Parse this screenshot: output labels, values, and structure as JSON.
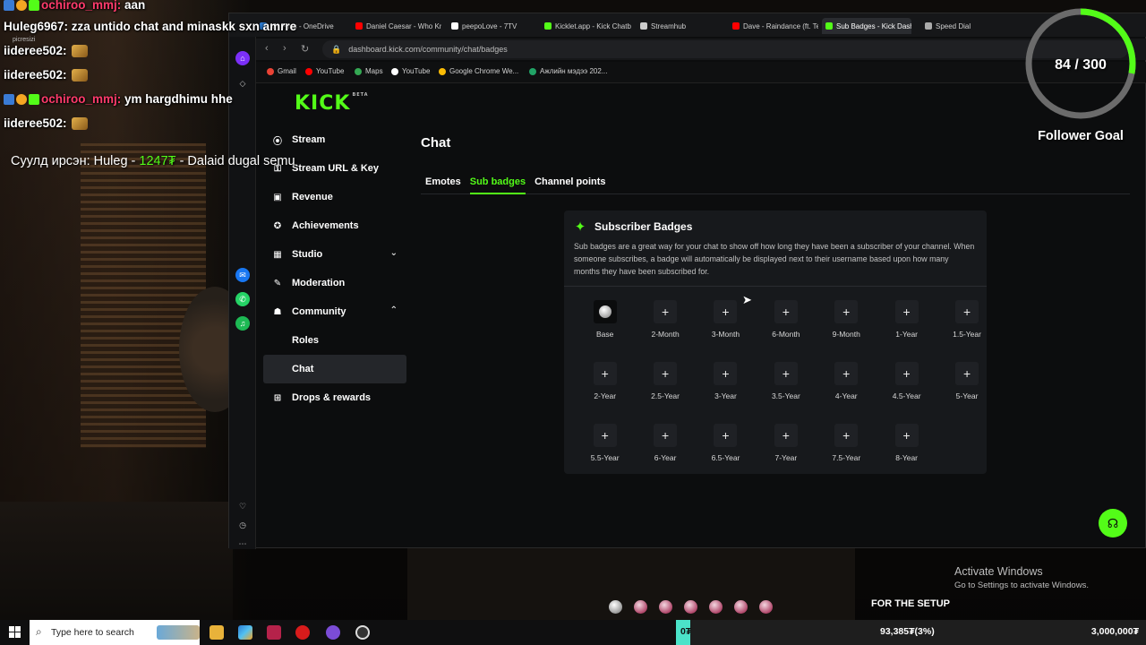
{
  "browser": {
    "tabs": [
      {
        "label": "My Files - OneDrive",
        "color": "#2b7cd3"
      },
      {
        "label": "Daniel Caesar - Who Kn",
        "color": "#ff0000"
      },
      {
        "label": "peepoLove - 7TV",
        "color": "#ffffff"
      },
      {
        "label": "Kicklet.app - Kick Chatb",
        "color": "#53fc18"
      },
      {
        "label": "Streamhub",
        "color": "#cccccc"
      },
      {
        "label": "Dave - Raindance (ft. Te",
        "color": "#ff0000"
      },
      {
        "label": "Sub Badges - Kick Dashb",
        "color": "#53fc18"
      },
      {
        "label": "Speed Dial",
        "color": "#aaaaaa"
      }
    ],
    "url": "dashboard.kick.com/community/chat/badges",
    "bookmarks": [
      {
        "label": "Gmail",
        "color": "#ea4335"
      },
      {
        "label": "YouTube",
        "color": "#ff0000"
      },
      {
        "label": "Maps",
        "color": "#34a853"
      },
      {
        "label": "YouTube",
        "color": "#ffffff"
      },
      {
        "label": "Google Chrome We...",
        "color": "#fbbc05"
      },
      {
        "label": "Ажлийн мэдээ 202...",
        "color": "#21a366"
      }
    ]
  },
  "kick": {
    "logo": "KICK",
    "logo_badge": "BETA",
    "nav": [
      {
        "label": "Stream",
        "icon": "((·))"
      },
      {
        "label": "Stream URL & Key",
        "icon": "⚿"
      },
      {
        "label": "Revenue",
        "icon": "▣"
      },
      {
        "label": "Achievements",
        "icon": "✪"
      },
      {
        "label": "Studio",
        "icon": "▦"
      },
      {
        "label": "Moderation",
        "icon": "🔧"
      },
      {
        "label": "Community",
        "icon": "👥"
      },
      {
        "label": "Roles",
        "icon": ""
      },
      {
        "label": "Chat",
        "icon": ""
      },
      {
        "label": "Drops & rewards",
        "icon": "⊞"
      }
    ],
    "page_title": "Chat",
    "tabs": [
      "Emotes",
      "Sub badges",
      "Channel points"
    ],
    "card": {
      "title": "Subscriber Badges",
      "description": "Sub badges are a great way for your chat to show off how long they have been a subscriber of your channel. When someone subscribes, a badge will automatically be displayed next to their username based upon how many months they have been subscribed for.",
      "badges": [
        "Base",
        "2-Month",
        "3-Month",
        "6-Month",
        "9-Month",
        "1-Year",
        "1.5-Year",
        "2-Year",
        "2.5-Year",
        "3-Year",
        "3.5-Year",
        "4-Year",
        "4.5-Year",
        "5-Year",
        "5.5-Year",
        "6-Year",
        "6.5-Year",
        "7-Year",
        "7.5-Year",
        "8-Year"
      ]
    }
  },
  "chat": {
    "mini_toolbar": "picresizi",
    "lines": [
      {
        "user": "ochiroo_mmj:",
        "msg": "aan",
        "user_color": "#ff3b6b"
      },
      {
        "user": "Huleg6967:",
        "msg": "zza untido chat and minaskk sxn amrre",
        "user_color": "#ffffff"
      },
      {
        "user": "iideree502:",
        "msg": "",
        "user_color": "#ffffff"
      },
      {
        "user": "iideree502:",
        "msg": "",
        "user_color": "#ffffff"
      },
      {
        "user": "ochiroo_mmj:",
        "msg": "ym hargdhimu hhe",
        "user_color": "#ff3b6b"
      },
      {
        "user": "iideree502:",
        "msg": "",
        "user_color": "#ffffff"
      }
    ],
    "donation_prefix": "Суулд ирсэн: Huleg - ",
    "donation_amount": "1247₮",
    "donation_suffix": " - Dalaid dugal semu"
  },
  "goal": {
    "count": "84 / 300",
    "current": 84,
    "target": 300,
    "label": "Follower Goal"
  },
  "windows": {
    "activate_title": "Activate Windows",
    "activate_sub": "Go to Settings to activate Windows.",
    "search_placeholder": "Type here to search"
  },
  "donation_bar": {
    "left": "0₮",
    "middle": "93,385₮(3%)",
    "right": "3,000,000₮",
    "progress": 0.03,
    "setup_label": "FOR THE SETUP"
  }
}
